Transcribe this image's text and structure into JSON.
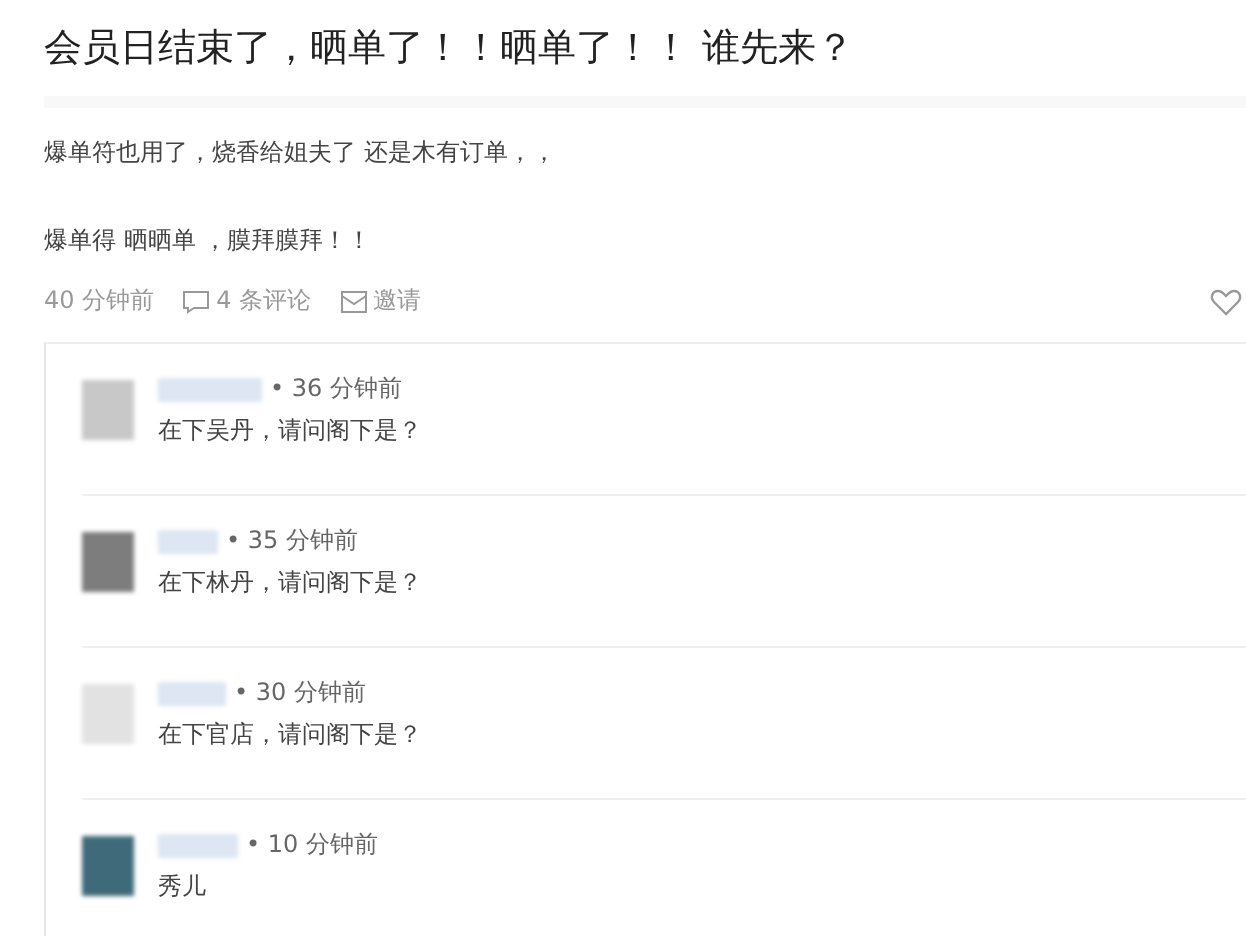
{
  "post": {
    "title": "会员日结束了，晒单了！！晒单了！！ 谁先来？",
    "paragraphs": [
      "爆单符也用了，烧香给姐夫了 还是木有订单，，",
      "爆单得 晒晒单 ，膜拜膜拜！！"
    ],
    "time": "40 分钟前",
    "comments_link": "4 条评论",
    "invite_link": "邀请"
  },
  "comments": [
    {
      "time": "• 36 分钟前",
      "text": "在下吴丹，请问阁下是？"
    },
    {
      "time": "• 35 分钟前",
      "text": "在下林丹，请问阁下是？"
    },
    {
      "time": "• 30 分钟前",
      "text": "在下官店，请问阁下是？"
    },
    {
      "time": "• 10 分钟前",
      "text": "秀儿"
    }
  ]
}
